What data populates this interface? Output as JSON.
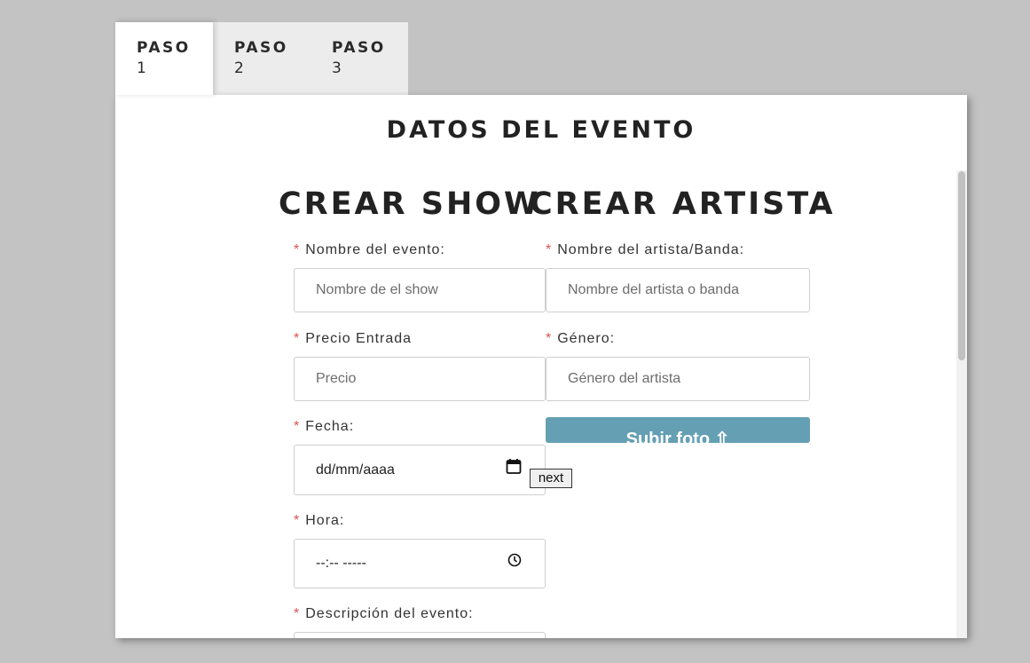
{
  "tabs": [
    {
      "label": "PASO",
      "number": "1"
    },
    {
      "label": "PASO",
      "number": "2"
    },
    {
      "label": "PASO",
      "number": "3"
    }
  ],
  "panel": {
    "title": "DATOS DEL EVENTO"
  },
  "show_section": {
    "title": "CREAR SHOW",
    "fields": {
      "nombre": {
        "required_mark": "*",
        "label": "Nombre del evento:",
        "placeholder": "Nombre de el show"
      },
      "precio": {
        "required_mark": "*",
        "label": "Precio Entrada",
        "placeholder": "Precio"
      },
      "fecha": {
        "required_mark": "*",
        "label": "Fecha:",
        "value": "dd/mm/aaaa",
        "icon": "calendar-icon"
      },
      "hora": {
        "required_mark": "*",
        "label": "Hora:",
        "value": "--:-- -----",
        "icon": "clock-icon"
      },
      "descripcion": {
        "required_mark": "*",
        "label": "Descripción del evento:"
      }
    }
  },
  "artist_section": {
    "title": "CREAR ARTISTA",
    "fields": {
      "nombre": {
        "required_mark": "*",
        "label": "Nombre del artista/Banda:",
        "placeholder": "Nombre del artista o banda"
      },
      "genero": {
        "required_mark": "*",
        "label": "Género:",
        "placeholder": "Género del artista"
      }
    },
    "upload_label": "Subir foto ⇧"
  },
  "next_label": "next",
  "colors": {
    "background": "#c3c3c3",
    "required": "#d9534f",
    "upload_button": "#659fb4"
  }
}
